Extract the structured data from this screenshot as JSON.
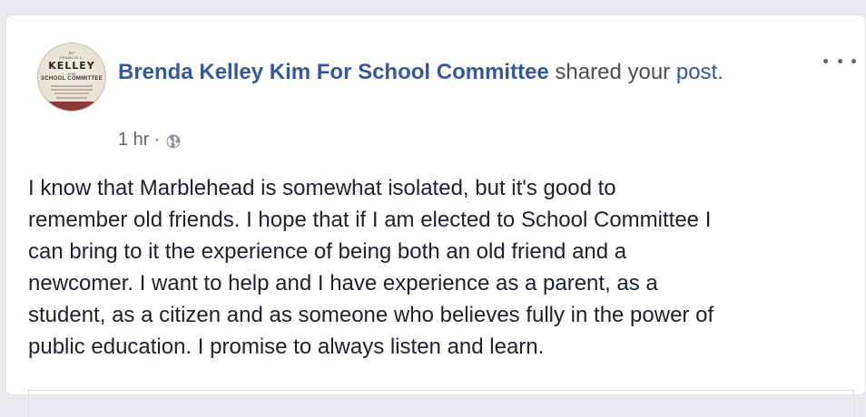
{
  "post": {
    "page_name": "Brenda Kelley Kim For School Committee",
    "shared_text": " shared your ",
    "post_link": "post.",
    "timestamp": "1 hr",
    "separator": "·",
    "privacy_icon": "globe-icon",
    "more_icon": "more-options-icon",
    "body": "I know that Marblehead is somewhat isolated, but it's good to\nremember old friends. I hope that if I am elected to School Committee I\ncan bring to it the experience of being both an old friend and a\nnewcomer. I want to help and I have experience as a parent, as a\nstudent, as a citizen and as someone who believes fully in the power of\npublic education. I promise to always listen and learn."
  },
  "avatar": {
    "top_line": "for",
    "small_name": "FRANCIS L.",
    "big_name": "KELLEY",
    "for_word": "FOR",
    "committee": "SCHOOL COMMITTEE"
  },
  "colors": {
    "link": "#365899",
    "meta": "#616770",
    "text": "#1d2129",
    "background": "#e9ebee"
  }
}
